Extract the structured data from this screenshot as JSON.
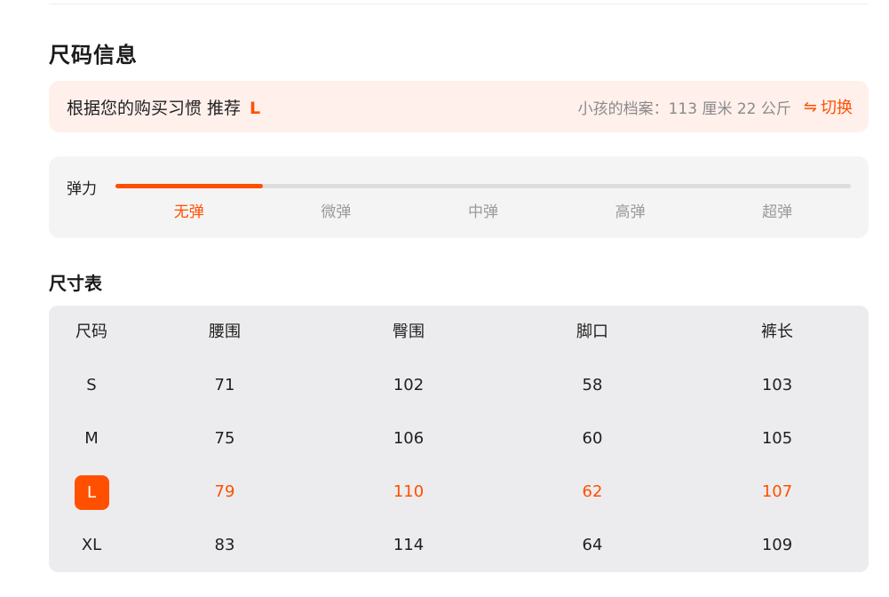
{
  "section_title": "尺码信息",
  "recommendation": {
    "prefix": "根据您的购买习惯 推荐",
    "size": "L",
    "profile_text": "小孩的档案：113 厘米 22 公斤",
    "switch_icon": "swap-arrows-icon",
    "switch_label": "切换"
  },
  "elasticity": {
    "label": "弹力",
    "levels": [
      "无弹",
      "微弹",
      "中弹",
      "高弹",
      "超弹"
    ],
    "active_level": "无弹",
    "fill_fraction": 0.2
  },
  "size_table": {
    "title": "尺寸表",
    "headers": [
      "尺码",
      "腰围",
      "臀围",
      "脚口",
      "裤长"
    ],
    "rows": [
      [
        "S",
        "71",
        "102",
        "58",
        "103"
      ],
      [
        "M",
        "75",
        "106",
        "60",
        "105"
      ],
      [
        "L",
        "79",
        "110",
        "62",
        "107"
      ],
      [
        "XL",
        "83",
        "114",
        "64",
        "109"
      ]
    ],
    "highlighted_size": "L"
  },
  "colors": {
    "accent": "#ff5000",
    "recommend_bg": "#fff0ec",
    "card_bg": "#f4f4f4",
    "table_bg": "#ececee"
  }
}
